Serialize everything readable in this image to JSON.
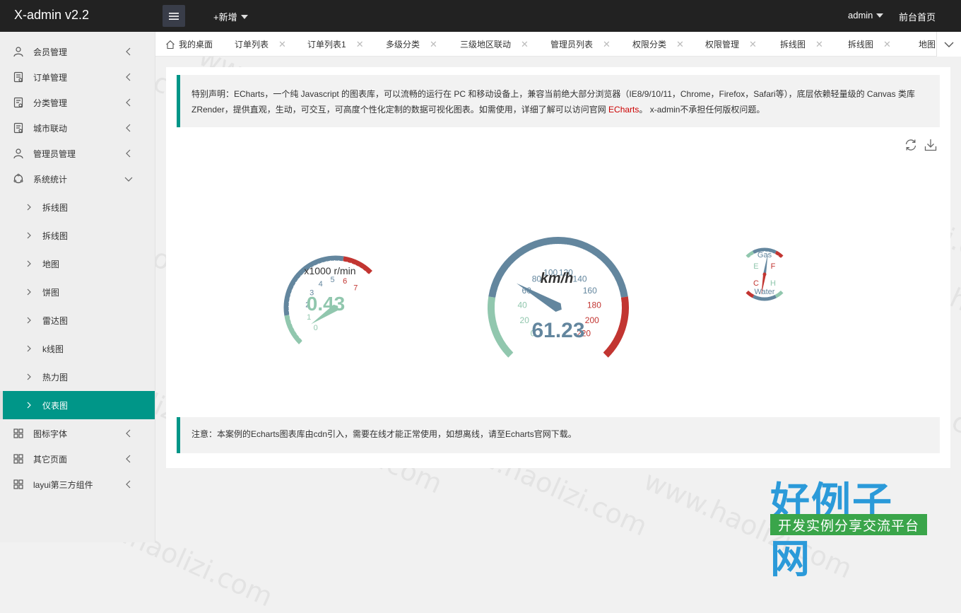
{
  "header": {
    "logo": "X-admin v2.2",
    "add_new": "+新增",
    "user": "admin",
    "front_home": "前台首页"
  },
  "sidebar": {
    "items": [
      {
        "label": "会员管理",
        "icon": "user-icon"
      },
      {
        "label": "订单管理",
        "icon": "order-icon"
      },
      {
        "label": "分类管理",
        "icon": "category-icon"
      },
      {
        "label": "城市联动",
        "icon": "city-icon"
      },
      {
        "label": "管理员管理",
        "icon": "admin-icon"
      },
      {
        "label": "系统统计",
        "icon": "stats-icon"
      }
    ],
    "subitems": [
      "拆线图",
      "拆线图",
      "地图",
      "饼图",
      "雷达图",
      "k线图",
      "热力图",
      "仪表图"
    ],
    "bottom_items": [
      {
        "label": "图标字体",
        "icon": "grid-icon"
      },
      {
        "label": "其它页面",
        "icon": "grid-icon"
      },
      {
        "label": "layui第三方组件",
        "icon": "grid-icon"
      }
    ]
  },
  "tabs": [
    "我的桌面",
    "订单列表",
    "订单列表1",
    "多级分类",
    "三级地区联动",
    "管理员列表",
    "权限分类",
    "权限管理",
    "拆线图",
    "拆线图",
    "地图"
  ],
  "notice": {
    "text1": "特别声明：ECharts，一个纯 Javascript 的图表库，可以流畅的运行在 PC 和移动设备上，兼容当前绝大部分浏览器（IE8/9/10/11，Chrome，Firefox，Safari等），底层依赖轻量级的 Canvas 类库 ZRender，提供直观，生动，可交互，可高度个性化定制的数据可视化图表。如需使用，详细了解可以访问官网 ",
    "link": "ECharts",
    "text2": "。 x-admin不承担任何版权问题。",
    "note": "注意：本案例的Echarts图表库由cdn引入，需要在线才能正常使用，如想离线，请至Echarts官网下载。"
  },
  "chart_data": {
    "type": "gauge",
    "gauges": [
      {
        "name": "x1000 r/min",
        "value": 0.43,
        "value_text": "0.43",
        "min": 0,
        "max": 7,
        "ticks": [
          "0",
          "1",
          "2",
          "3",
          "4",
          "5",
          "6",
          "7"
        ]
      },
      {
        "name": "km/h",
        "value": 61.23,
        "value_text": "61.23",
        "min": 0,
        "max": 220,
        "ticks": [
          "0",
          "20",
          "40",
          "60",
          "80",
          "100",
          "120",
          "140",
          "160",
          "180",
          "200",
          "220"
        ]
      },
      {
        "name": "Gas",
        "value": 1.2,
        "min": 0,
        "max": 2,
        "ticks": [
          "E",
          "F"
        ]
      },
      {
        "name": "Water",
        "value": 0.8,
        "min": 0,
        "max": 2,
        "ticks": [
          "C",
          "H"
        ]
      }
    ],
    "colors": {
      "low": "#91c7ae",
      "mid": "#63869e",
      "high": "#c23531"
    }
  },
  "brand": {
    "title": "好例子网",
    "subtitle": "开发实例分享交流平台"
  },
  "watermark": "www.haolizi.com"
}
